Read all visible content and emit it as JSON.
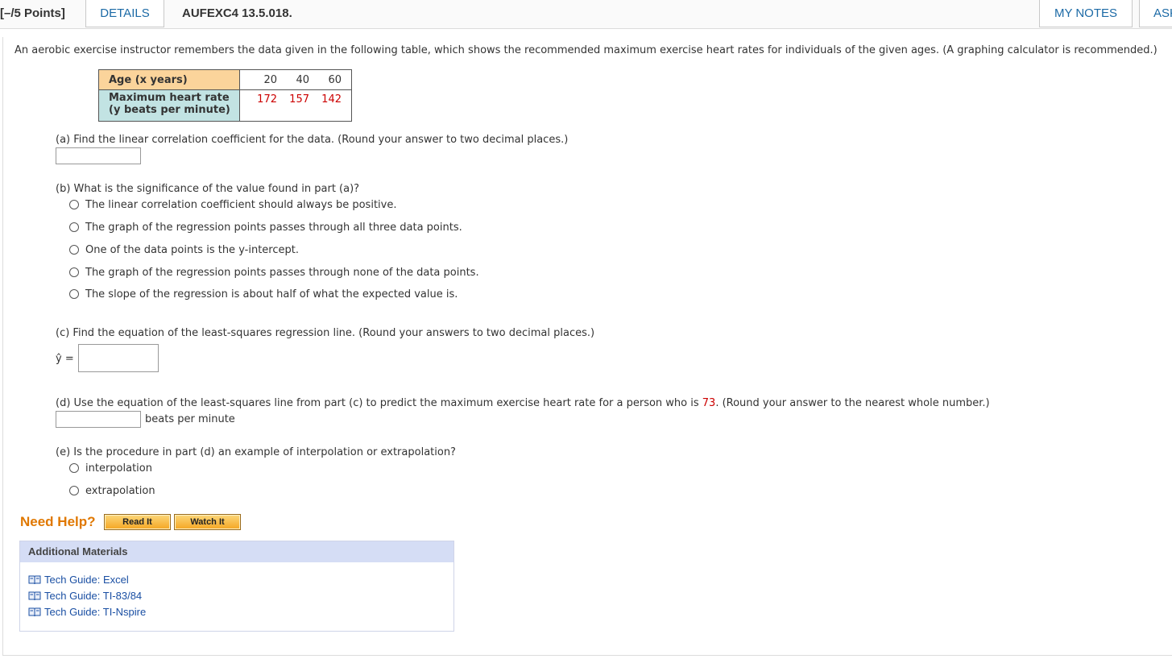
{
  "header": {
    "points": "[–/5 Points]",
    "details_label": "DETAILS",
    "problem_code": "AUFEXC4 13.5.018.",
    "my_notes_label": "MY NOTES",
    "ask_label": "ASK"
  },
  "intro": "An aerobic exercise instructor remembers the data given in the following table, which shows the recommended maximum exercise heart rates for individuals of the given ages. (A graphing calculator is recommended.)",
  "table": {
    "row1_label": "Age (x years)",
    "row2_label_line1": "Maximum heart rate",
    "row2_label_line2": "(y beats per minute)",
    "ages": [
      "20",
      "40",
      "60"
    ],
    "rates": [
      "172",
      "157",
      "142"
    ]
  },
  "part_a": {
    "question": "(a) Find the linear correlation coefficient for the data. (Round your answer to two decimal places.)",
    "answer": ""
  },
  "part_b": {
    "question": "(b) What is the significance of the value found in part (a)?",
    "options": [
      "The linear correlation coefficient should always be positive.",
      "The graph of the regression points passes through all three data points.",
      "One of the data points is the y-intercept.",
      "The graph of the regression points passes through none of the data points.",
      "The slope of the regression is about half of what the expected value is."
    ]
  },
  "part_c": {
    "question": "(c) Find the equation of the least-squares regression line. (Round your answers to two decimal places.)",
    "yhat_label": "ŷ =",
    "answer": ""
  },
  "part_d": {
    "question_before": "(d) Use the equation of the least-squares line from part (c) to predict the maximum exercise heart rate for a person who is ",
    "age_value": "73",
    "question_after": ". (Round your answer to the nearest whole number.)",
    "unit": "beats per minute",
    "answer": ""
  },
  "part_e": {
    "question": "(e) Is the procedure in part (d) an example of interpolation or extrapolation?",
    "options": [
      "interpolation",
      "extrapolation"
    ]
  },
  "help": {
    "label": "Need Help?",
    "read_it": "Read It",
    "watch_it": "Watch It"
  },
  "additional_materials": {
    "title": "Additional Materials",
    "links": [
      "Tech Guide: Excel",
      "Tech Guide: TI-83/84",
      "Tech Guide: TI-Nspire"
    ]
  },
  "colors": {
    "link_blue": "#1c6aa6",
    "table_age_bg": "#fbd49b",
    "table_rate_bg": "#c2e3e3",
    "red_value": "#cc0000",
    "need_help_orange": "#e07800",
    "materials_header_bg": "#d5ddf5"
  }
}
